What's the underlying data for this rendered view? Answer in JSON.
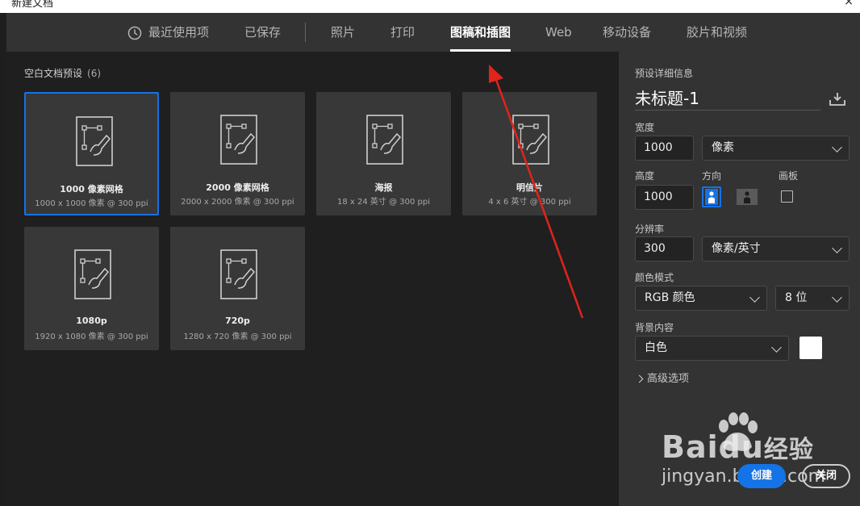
{
  "window": {
    "title": "新建文档",
    "close_glyph": "×"
  },
  "tabs": [
    {
      "label": "最近使用项",
      "icon": "clock-icon"
    },
    {
      "label": "已保存"
    },
    {
      "label": "照片"
    },
    {
      "label": "打印"
    },
    {
      "label": "图稿和插图",
      "active": true
    },
    {
      "label": "Web"
    },
    {
      "label": "移动设备"
    },
    {
      "label": "胶片和视频"
    }
  ],
  "presets": {
    "section_title": "空白文档预设",
    "count": "(6)",
    "items": [
      {
        "name": "1000 像素网格",
        "size": "1000 x 1000 像素 @ 300 ppi",
        "selected": true
      },
      {
        "name": "2000 像素网格",
        "size": "2000 x 2000 像素 @ 300 ppi"
      },
      {
        "name": "海报",
        "size": "18 x 24 英寸 @ 300 ppi"
      },
      {
        "name": "明信片",
        "size": "4 x 6 英寸 @ 300 ppi"
      },
      {
        "name": "1080p",
        "size": "1920 x 1080 像素 @ 300 ppi"
      },
      {
        "name": "720p",
        "size": "1280 x 720 像素 @ 300 ppi"
      }
    ]
  },
  "details": {
    "header": "预设详细信息",
    "doc_name": "未标题-1",
    "width_label": "宽度",
    "width_value": "1000",
    "width_unit": "像素",
    "height_label": "高度",
    "height_value": "1000",
    "orientation_label": "方向",
    "artboard_label": "画板",
    "resolution_label": "分辨率",
    "resolution_value": "300",
    "resolution_unit": "像素/英寸",
    "color_mode_label": "颜色模式",
    "color_mode_value": "RGB 颜色",
    "bit_depth": "8 位",
    "background_label": "背景内容",
    "background_value": "白色",
    "background_color": "#ffffff",
    "advanced_label": "高级选项"
  },
  "buttons": {
    "create": "创建",
    "close": "关闭"
  },
  "watermark": {
    "brand": "Bai",
    "brand2": "du",
    "brand_cn": "经验",
    "url": "jingyan.baidu.com"
  },
  "colors": {
    "accent": "#1473e6",
    "annotation_arrow": "#e0241c"
  }
}
